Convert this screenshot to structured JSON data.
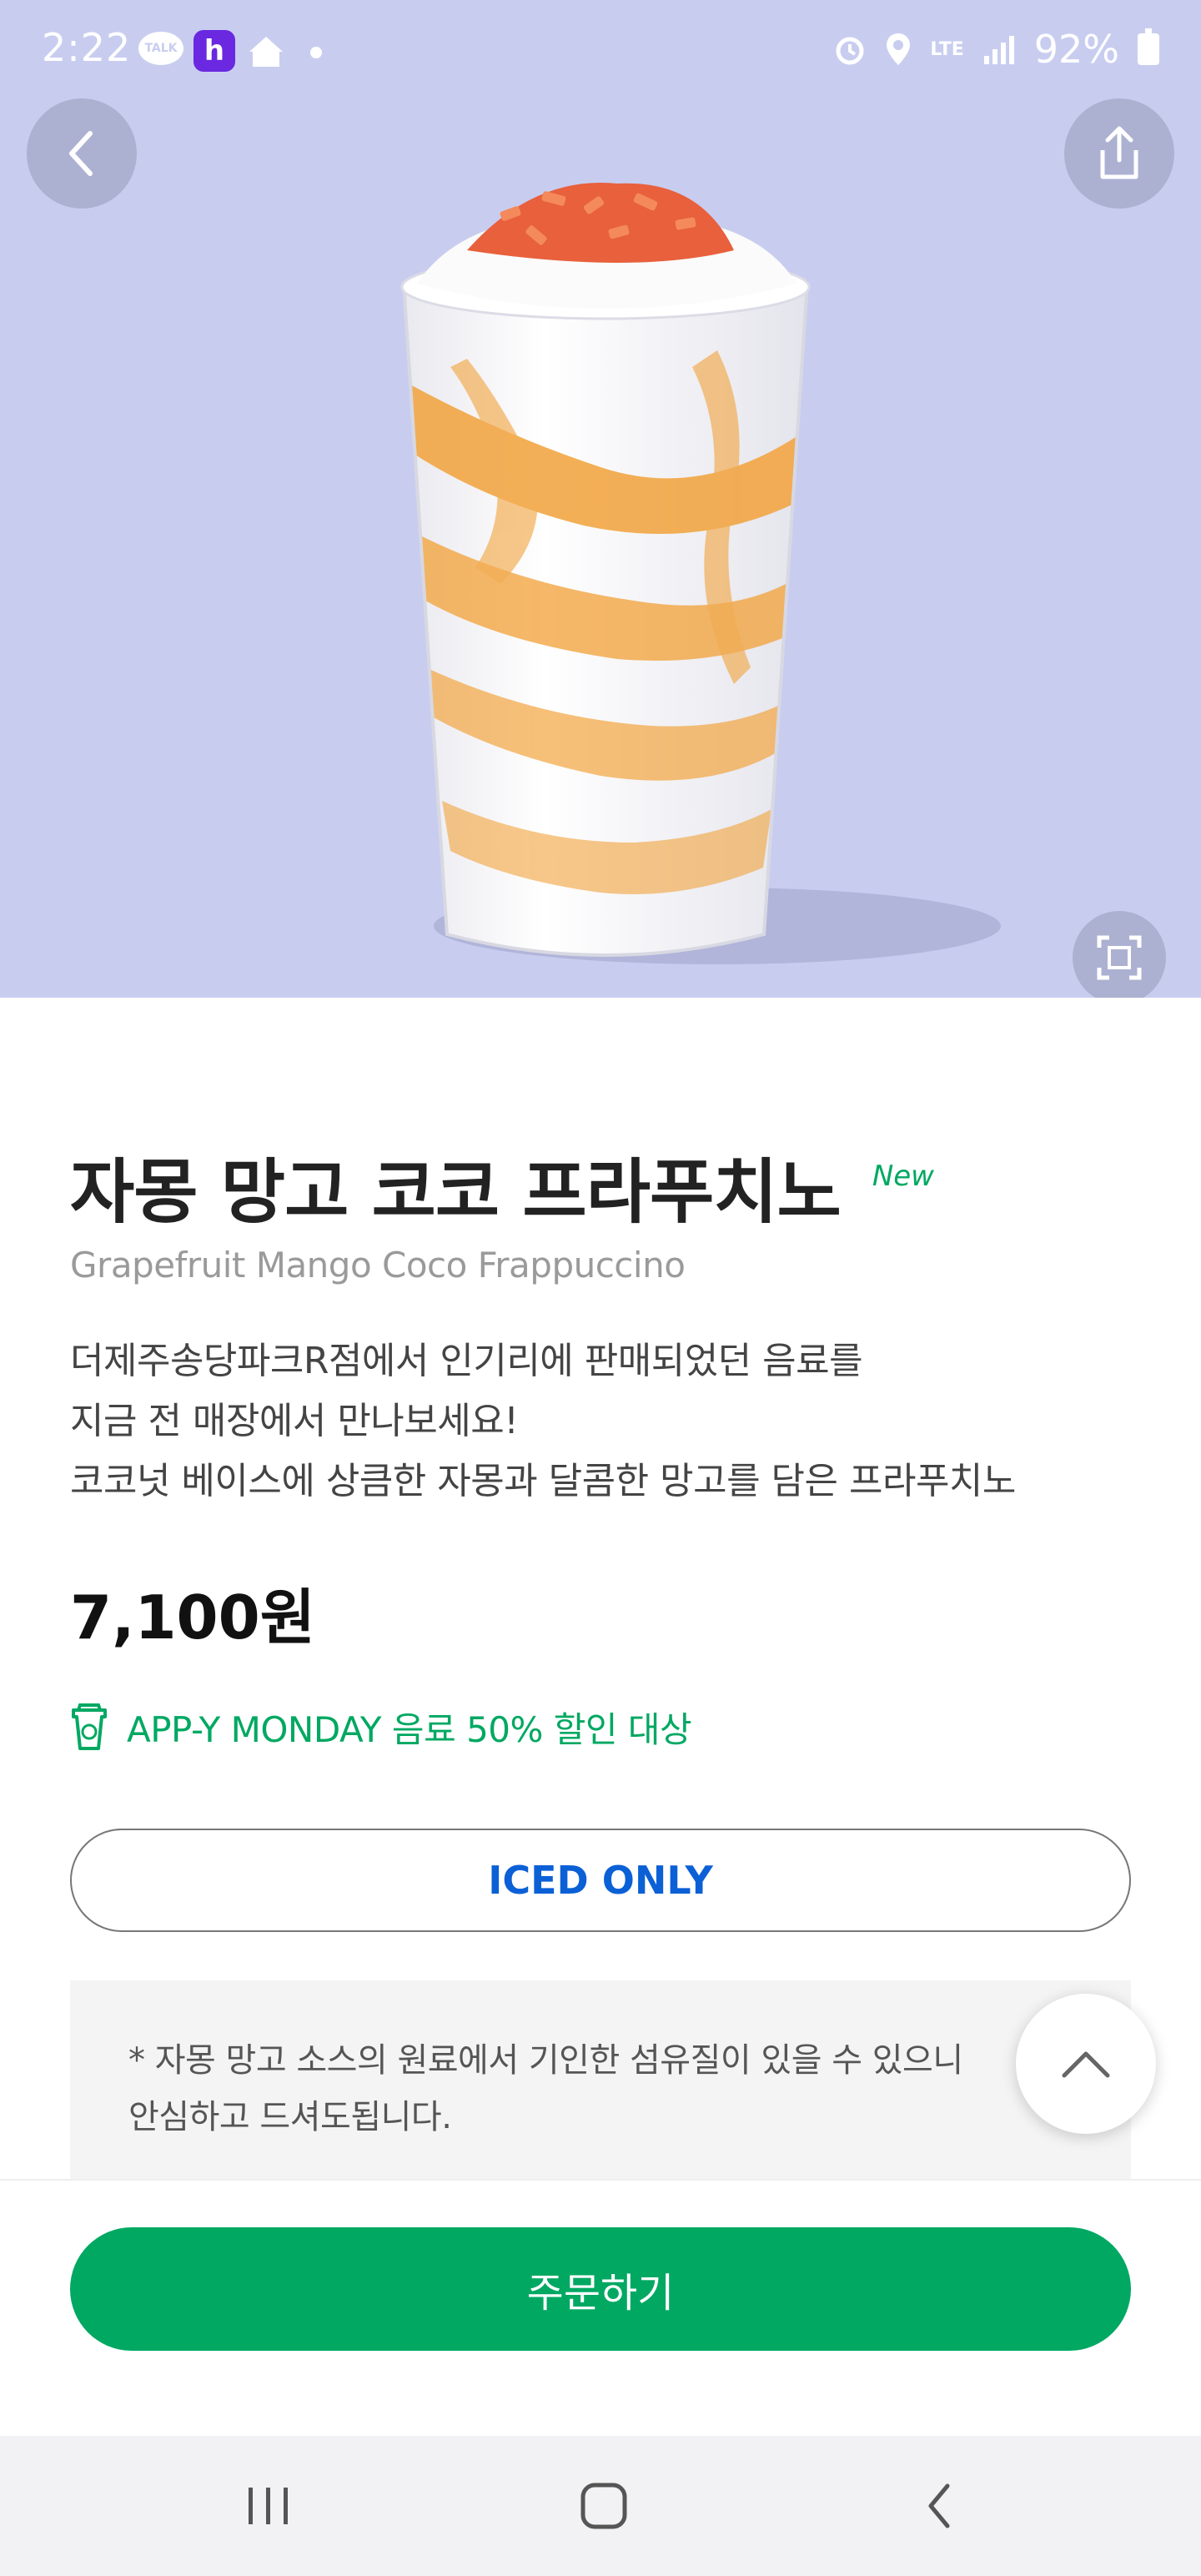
{
  "status_bar": {
    "time": "2:22",
    "notification_icons": [
      "kakaotalk-icon",
      "h-app-icon",
      "smart-home-icon",
      "dot-icon"
    ],
    "talk_label": "TALK",
    "h_label": "h",
    "system_icons": [
      "alarm-icon",
      "location-icon",
      "lte-icon",
      "signal-icon",
      "battery-icon"
    ],
    "network": "LTE",
    "battery": "92%"
  },
  "header": {
    "back_icon": "chevron-left-icon",
    "share_icon": "share-icon",
    "expand_icon": "fullscreen-icon"
  },
  "product": {
    "name_ko": "자몽 망고 코코 프라푸치노",
    "badge": "New",
    "name_en": "Grapefruit Mango Coco Frappuccino",
    "description": [
      "더제주송당파크R점에서 인기리에 판매되었던 음료를",
      "지금 전 매장에서 만나보세요!",
      "코코넛 베이스에 상큼한 자몽과 달콤한 망고를 담은 프라푸치노"
    ],
    "price": "7,100원",
    "promo": "APP-Y MONDAY 음료 50% 할인 대상",
    "temperature_option": "ICED ONLY",
    "notice": [
      "* 자몽 망고 소스의 원료에서 기인한 섬유질이 있을 수 있으니",
      "안심하고 드셔도됩니다."
    ]
  },
  "actions": {
    "order_label": "주문하기",
    "scroll_top_icon": "chevron-up-icon"
  },
  "navigation_bar": {
    "buttons": [
      "recent-apps-icon",
      "home-icon",
      "back-icon"
    ]
  },
  "colors": {
    "brand_green": "#00a862",
    "iced_blue": "#0b60d6",
    "hero_background": "#c8cdf0"
  }
}
